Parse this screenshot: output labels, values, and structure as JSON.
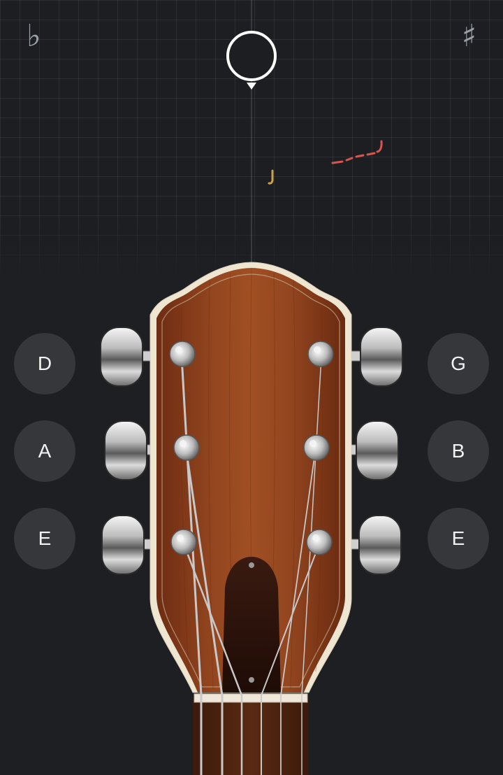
{
  "tuner": {
    "flat_symbol": "♭",
    "sharp_symbol": "♯"
  },
  "strings": {
    "left": [
      {
        "note": "D"
      },
      {
        "note": "A"
      },
      {
        "note": "E"
      }
    ],
    "right": [
      {
        "note": "G"
      },
      {
        "note": "B"
      },
      {
        "note": "E"
      }
    ]
  },
  "colors": {
    "background": "#1d1f22",
    "button_bg": "#35373b",
    "wood": "#8a3f1c",
    "trace_red": "#d9534f",
    "trace_amber": "#c8a34a"
  },
  "icons": {
    "flat": "flat-icon",
    "sharp": "sharp-icon",
    "indicator": "pitch-indicator-icon"
  }
}
